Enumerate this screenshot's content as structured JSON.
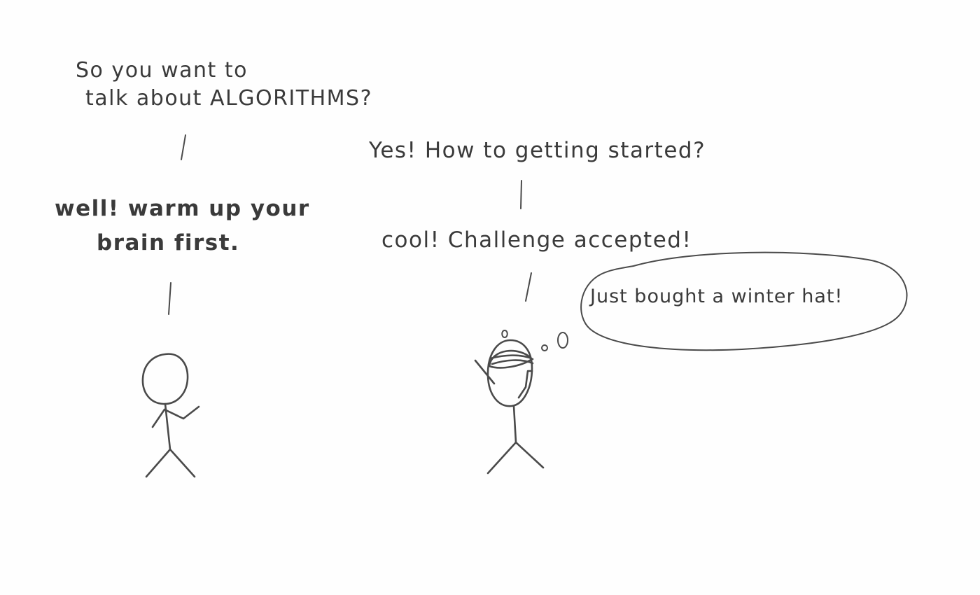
{
  "dialogue": [
    {
      "speaker": "left",
      "lines": [
        "So you want to",
        "talk about ALGORITHMS?"
      ]
    },
    {
      "speaker": "right",
      "lines": [
        "Yes! How to getting started?"
      ]
    },
    {
      "speaker": "left",
      "lines": [
        "well! warm up your",
        "brain first."
      ]
    },
    {
      "speaker": "right",
      "lines": [
        "cool! Challenge accepted!"
      ]
    }
  ],
  "thought": "Just bought a winter hat!"
}
